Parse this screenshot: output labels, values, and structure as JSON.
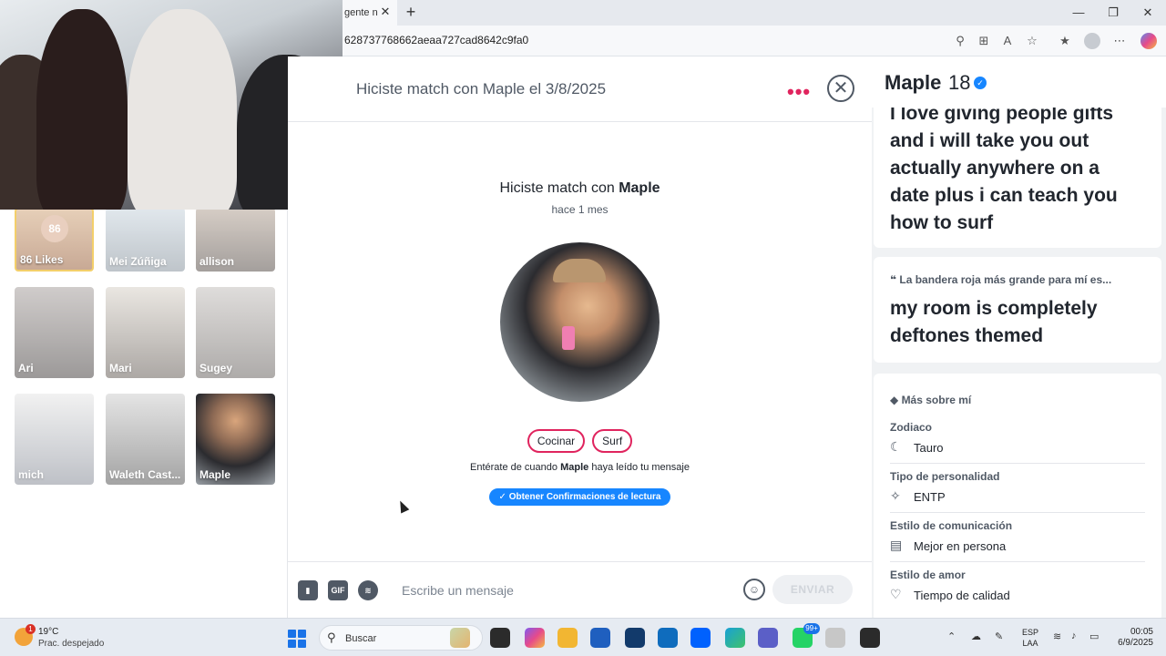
{
  "browser": {
    "tab_title": "gente n",
    "url": "628737768662aeaa727cad8642c9fa0"
  },
  "matches": [
    {
      "name": "86 Likes",
      "count": "86"
    },
    {
      "name": "Mei Zúñiga"
    },
    {
      "name": "allison"
    },
    {
      "name": "Ari"
    },
    {
      "name": "Mari"
    },
    {
      "name": "Sugey"
    },
    {
      "name": "mich"
    },
    {
      "name": "Waleth Cast..."
    },
    {
      "name": "Maple"
    }
  ],
  "chat": {
    "header_title": "Hiciste match con Maple el 3/8/2025",
    "match_prefix": "Hiciste match con",
    "match_name": "Maple",
    "match_ago": "hace 1 mes",
    "interests": [
      "Cocinar",
      "Surf"
    ],
    "notice_prefix": "Entérate de cuando",
    "notice_name": "Maple",
    "notice_suffix": "haya leído tu mensaje",
    "receipts_button": "Obtener Confirmaciones de lectura",
    "composer_placeholder": "Escribe un mensaje",
    "gif_label": "GIF",
    "send_label": "ENVIAR"
  },
  "profile": {
    "name": "Maple",
    "age": "18",
    "bio_line_1": "I love giving people gifts",
    "bio_line_2": "and i will take you out",
    "bio_line_3": "actually anywhere on a",
    "bio_line_4": "date plus i can teach you",
    "bio_line_5": "how to surf",
    "prompt_question": "La bandera roja más grande para mí es...",
    "prompt_answer_1": "my room is completely",
    "prompt_answer_2": "deftones themed",
    "about_title": "Más sobre mí",
    "fields": [
      {
        "label": "Zodiaco",
        "value": "Tauro",
        "icon": "moon-icon"
      },
      {
        "label": "Tipo de personalidad",
        "value": "ENTP",
        "icon": "puzzle-icon"
      },
      {
        "label": "Estilo de comunicación",
        "value": "Mejor en persona",
        "icon": "chat-icon"
      },
      {
        "label": "Estilo de amor",
        "value": "Tiempo de calidad",
        "icon": "heart-chat-icon"
      }
    ]
  },
  "taskbar": {
    "temperature": "19°C",
    "condition": "Prac. despejado",
    "weather_badge": "1",
    "search_label": "Buscar",
    "teams_badge": "99+",
    "lang_1": "ESP",
    "lang_2": "LAA",
    "time": "00:05",
    "date": "6/9/2025"
  },
  "colors": {
    "accent": "#e0245e",
    "blue": "#1786ff"
  }
}
